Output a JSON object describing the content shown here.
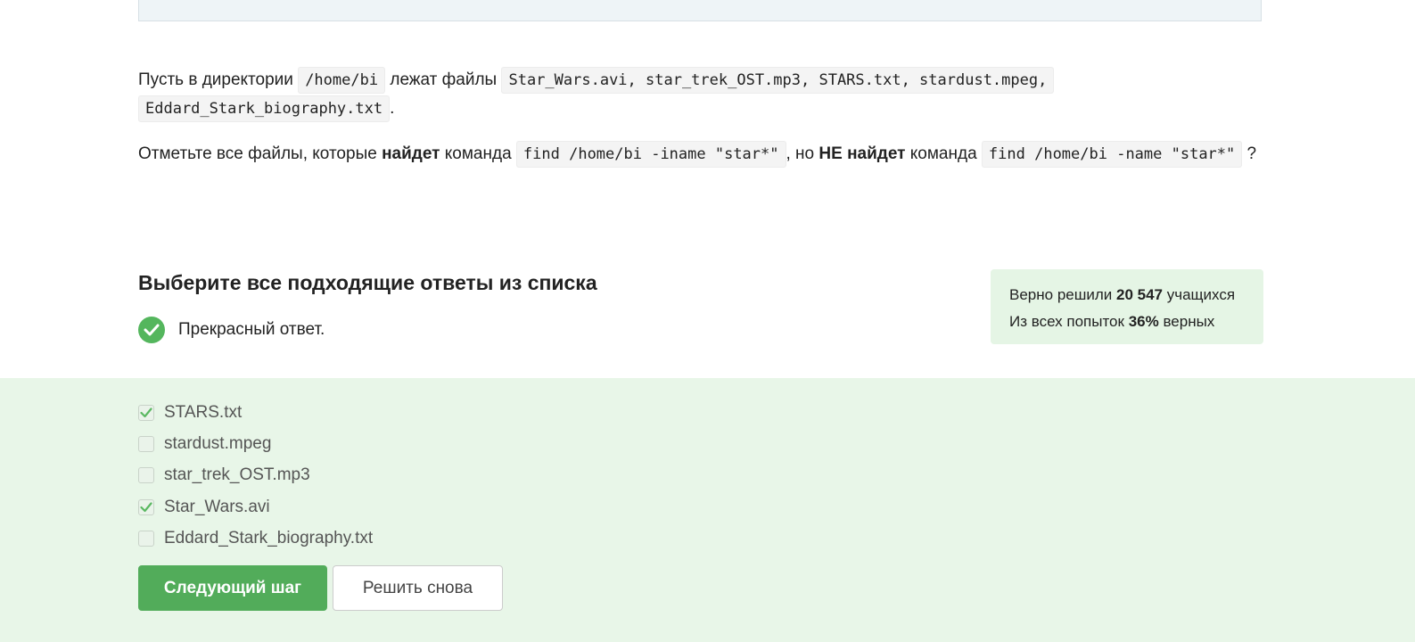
{
  "question": {
    "p1": {
      "t1": "Пусть в директории",
      "c1": "/home/bi",
      "t2": "лежат файлы",
      "c2": "Star_Wars.avi, star_trek_OST.mp3, STARS.txt, stardust.mpeg, Eddard_Stark_biography.txt",
      "t3": "."
    },
    "p2": {
      "t1": "Отметьте все файлы, которые",
      "b1": "найдет",
      "t2": "команда",
      "c1": "find /home/bi -iname \"star*\"",
      "t3": ", но",
      "b2": "НЕ найдет",
      "t4": "команда",
      "c2": "find /home/bi -name \"star*\"",
      "t5": "?"
    }
  },
  "choose_title": "Выберите все подходящие ответы из списка",
  "feedback": {
    "icon": "check-circle-icon",
    "text": "Прекрасный ответ."
  },
  "stats": {
    "l1_pre": "Верно решили",
    "l1_num": "20 547",
    "l1_post": "учащихся",
    "l2_pre": "Из всех попыток",
    "l2_num": "36%",
    "l2_post": "верных"
  },
  "options": [
    {
      "label": "STARS.txt",
      "checked": true
    },
    {
      "label": "stardust.mpeg",
      "checked": false
    },
    {
      "label": "star_trek_OST.mp3",
      "checked": false
    },
    {
      "label": "Star_Wars.avi",
      "checked": true
    },
    {
      "label": "Eddard_Stark_biography.txt",
      "checked": false
    }
  ],
  "buttons": {
    "next": "Следующий шаг",
    "retry": "Решить снова"
  },
  "colors": {
    "accent_green": "#52ac5a",
    "answers_bg": "#e8f6e8",
    "stats_bg": "#e5f5e5"
  }
}
